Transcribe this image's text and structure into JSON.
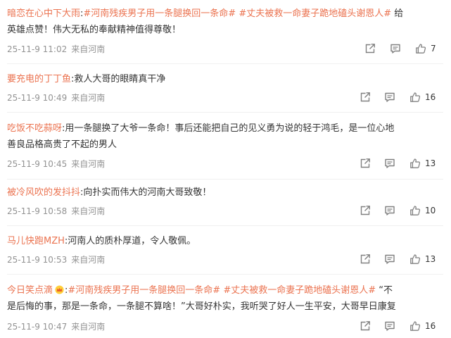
{
  "comments": [
    {
      "user": "暗恋在心中下大雨",
      "colon": ":",
      "topics": [
        "#河南残疾男子用一条腿换回一条命#",
        "#丈夫被救一命妻子跪地磕头谢恩人#"
      ],
      "line1_text": " 给",
      "line2": "英雄点赞！伟大无私的奉献精神值得尊敬！",
      "time": "25-11-9 11:02",
      "source": "来自河南",
      "likes": "7"
    },
    {
      "user": "要充电的丁丁鱼",
      "colon": ":",
      "text": "救人大哥的眼睛真干净",
      "time": "25-11-9 10:49",
      "source": "来自河南",
      "likes": "16"
    },
    {
      "user": "吃饭不吃蒜呀",
      "colon": ":",
      "line1_text": "用一条腿换了大爷一条命！事后还能把自己的见义勇为说的轻于鸿毛，是一位心地",
      "line2": "善良品格高贵了不起的男人",
      "time": "25-11-9 10:45",
      "source": "来自河南",
      "likes": "13"
    },
    {
      "user": "被冷风吹的发抖抖",
      "colon": ":",
      "text": "向扑实而伟大的河南大哥致敬！",
      "time": "25-11-9 10:58",
      "source": "来自河南",
      "likes": "10"
    },
    {
      "user": "马儿快跑MZH",
      "colon": ":",
      "text": "河南人的质朴厚道，令人敬佩。",
      "time": "25-11-9 10:53",
      "source": "来自河南",
      "likes": "13"
    },
    {
      "user": "今日笑点滴",
      "colon": ":",
      "topics": [
        "#河南残疾男子用一条腿换回一条命#",
        "#丈夫被救一命妻子跪地磕头谢恩人#"
      ],
      "line1_text": " “不",
      "line2": "是后悔的事，那是一条命，一条腿不算啥！”大哥好朴实，我听哭了好人一生平安，大哥早日康复",
      "time": "25-11-9 10:47",
      "source": "来自河南",
      "likes": "16"
    }
  ],
  "colors": {
    "link": "#eb7350",
    "meta": "#939393",
    "text": "#333333",
    "icon": "#808080"
  },
  "icons": [
    "share-icon",
    "comment-icon",
    "like-icon",
    "vip-crown-icon"
  ]
}
